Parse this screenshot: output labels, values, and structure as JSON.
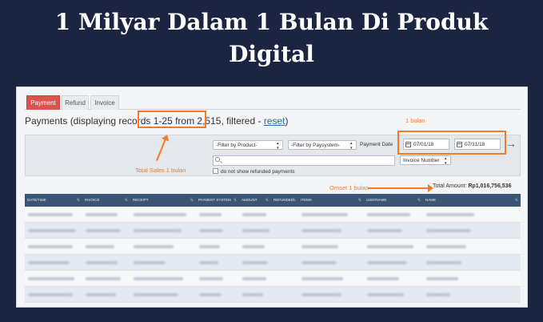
{
  "headline": {
    "line1": "1 Milyar Dalam 1 Bulan Di Produk",
    "line2": "Digital"
  },
  "tabs": [
    {
      "label": "Payment",
      "active": true
    },
    {
      "label": "Refund",
      "active": false
    },
    {
      "label": "Invoice",
      "active": false
    }
  ],
  "heading": {
    "prefix": "Payments (displaying records ",
    "records": "1-25 from 2,515",
    "suffix": ", filtered - ",
    "reset": "reset",
    "close": ")"
  },
  "filters": {
    "product": "-Filter by Product-",
    "paysystem": "-Filter by Paysystem-",
    "payment_date_label": "Payment Date",
    "date_from": "07/01/18",
    "date_to": "07/31/18",
    "search_value": "",
    "invoice_select": "Invoice Number",
    "refund_checkbox_label": "do not show refunded payments",
    "refund_checked": false
  },
  "annotations": {
    "one_month": "1 bulan",
    "total_sales": "Total Sales 1 bulan",
    "omset": "Omset 1 bulan",
    "color": "#f07c2a"
  },
  "total": {
    "label": "Total Amount: ",
    "value": "Rp1,016,756,536"
  },
  "table": {
    "columns": [
      "DATE/TIME",
      "INVOICE",
      "RECEIPT",
      "PAYMENT SYSTEM",
      "AMOUNT",
      "REFUNDED",
      "ITEMS",
      "USERNAME",
      "NAME"
    ],
    "rows_visible": 6,
    "note": "cell values are blurred in the screenshot"
  }
}
